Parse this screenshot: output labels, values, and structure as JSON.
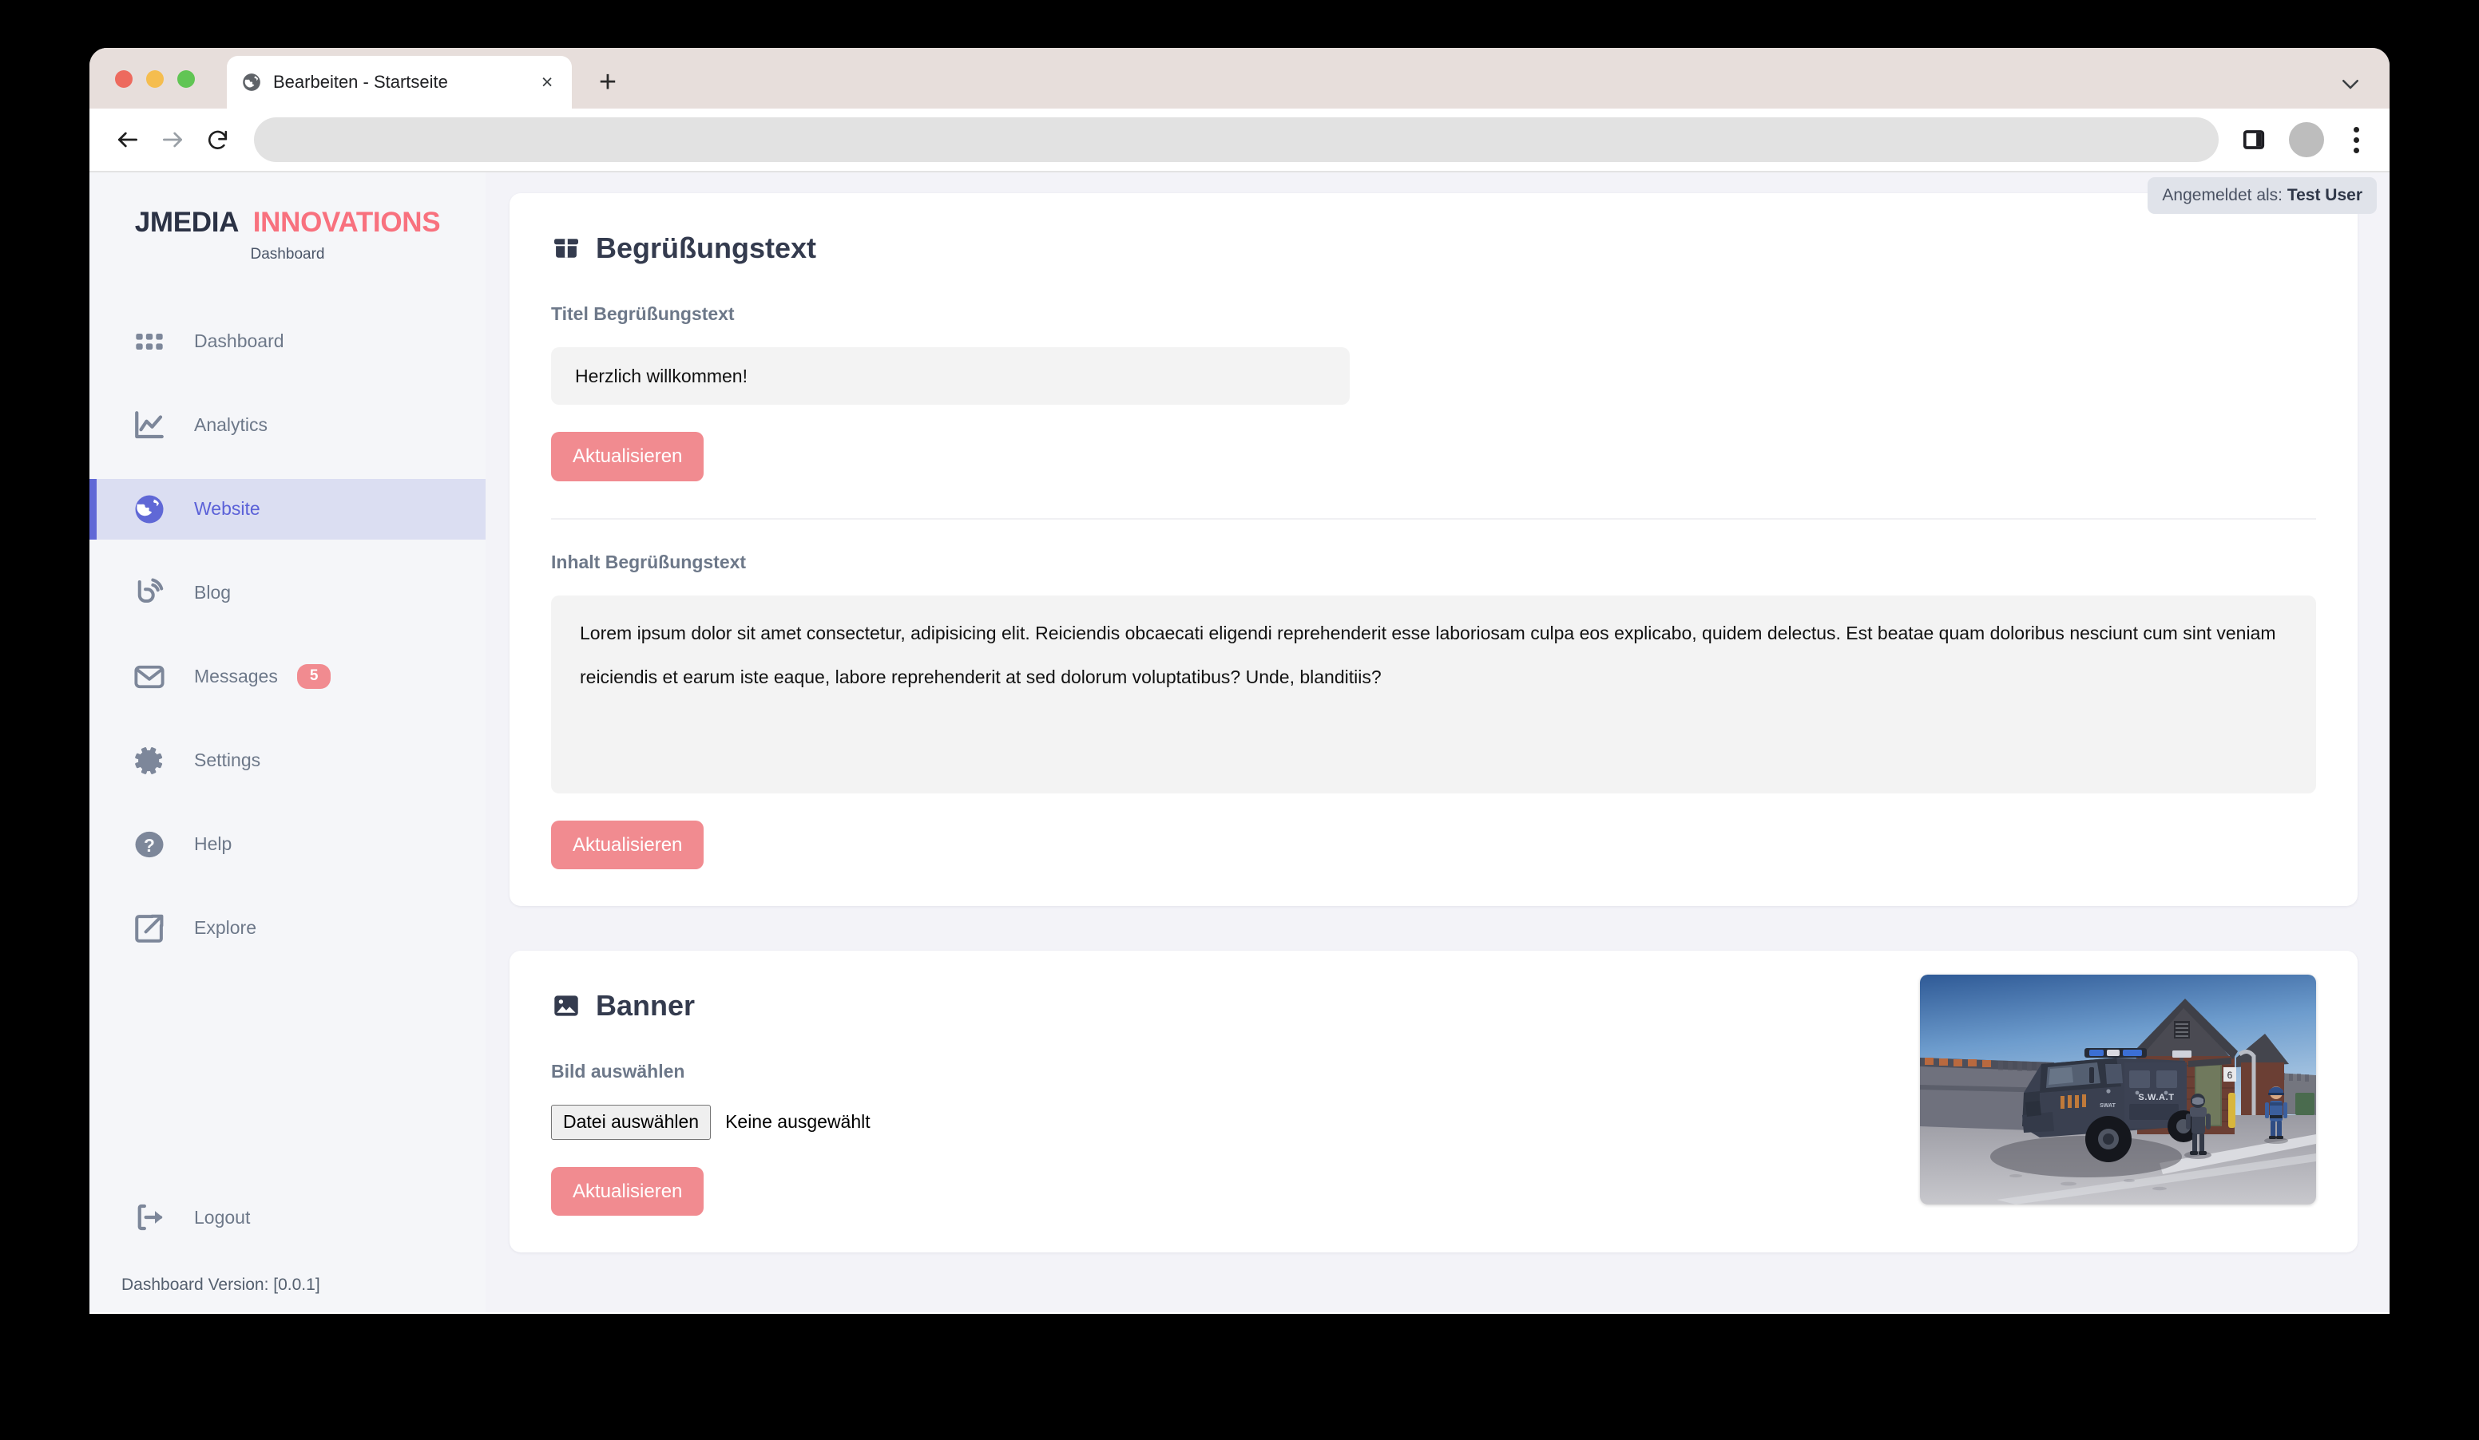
{
  "browser": {
    "tab": {
      "title": "Bearbeiten - Startseite",
      "favicon": "globe-icon",
      "close_label": "×"
    },
    "new_tab_label": "+",
    "address_value": "",
    "toolbar_icons": [
      "back-arrow-icon",
      "forward-arrow-icon",
      "reload-icon",
      "side-panel-icon",
      "profile-avatar",
      "three-dot-menu-icon"
    ]
  },
  "sidebar": {
    "brand": {
      "name_part1": "JMEDIA",
      "name_part2": "INNOVATIONS",
      "subtitle": "Dashboard"
    },
    "items": [
      {
        "label": "Dashboard",
        "icon": "grid-icon",
        "active": false,
        "badge": ""
      },
      {
        "label": "Analytics",
        "icon": "chart-line-icon",
        "active": false,
        "badge": ""
      },
      {
        "label": "Website",
        "icon": "globe-icon",
        "active": true,
        "badge": ""
      },
      {
        "label": "Blog",
        "icon": "blogger-icon",
        "active": false,
        "badge": ""
      },
      {
        "label": "Messages",
        "icon": "envelope-icon",
        "active": false,
        "badge": "5"
      },
      {
        "label": "Settings",
        "icon": "gear-icon",
        "active": false,
        "badge": ""
      },
      {
        "label": "Help",
        "icon": "question-circle-icon",
        "active": false,
        "badge": ""
      },
      {
        "label": "Explore",
        "icon": "external-link-icon",
        "active": false,
        "badge": ""
      }
    ],
    "logout_label": "Logout",
    "logout_icon": "logout-arrow-icon",
    "version_text": "Dashboard Version: [0.0.1]"
  },
  "header": {
    "login_prefix": "Angemeldet als: ",
    "login_user": "Test User"
  },
  "greeting_card": {
    "heading": "Begrüßungstext",
    "heading_icon": "box-icon",
    "title_label": "Titel Begrüßungstext",
    "title_value": "Herzlich willkommen!",
    "title_update_button": "Aktualisieren",
    "content_label": "Inhalt Begrüßungstext",
    "content_value": "Lorem ipsum dolor sit amet consectetur, adipisicing elit. Reiciendis obcaecati eligendi reprehenderit esse laboriosam culpa eos explicabo, quidem delectus. Est beatae quam doloribus nesciunt cum sint veniam reiciendis et earum iste eaque, labore reprehenderit at sed dolorum voluptatibus? Unde, blanditiis?",
    "content_update_button": "Aktualisieren"
  },
  "banner_card": {
    "heading": "Banner",
    "heading_icon": "image-icon",
    "file_label": "Bild auswählen",
    "file_button": "Datei auswählen",
    "file_status": "Keine ausgewählt",
    "update_button": "Aktualisieren",
    "preview_alt": "swat-truck-banner-image"
  },
  "colors": {
    "accent_coral": "#f18b90",
    "brand_accent": "#f8717e",
    "active_indigo": "#6068d6",
    "active_bg": "#dbdef2",
    "sidebar_bg": "#f5f6f9",
    "page_bg": "#f3f3f8",
    "heading_dark": "#343b4e",
    "label_gray": "#6d7889"
  }
}
